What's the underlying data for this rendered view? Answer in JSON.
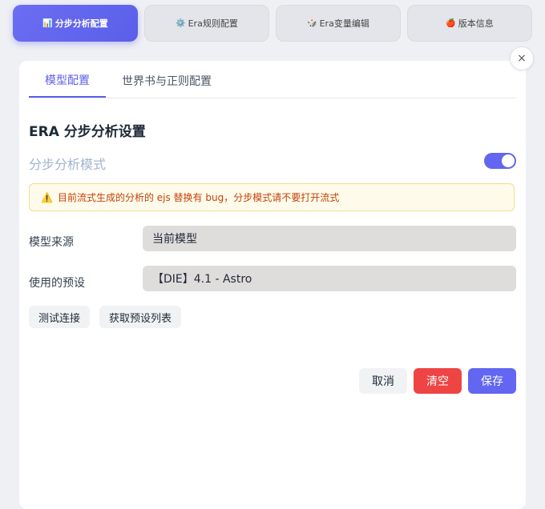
{
  "top_tabs": [
    {
      "icon": "📊",
      "label": "分步分析配置"
    },
    {
      "icon": "⚙️",
      "label": "Era规则配置"
    },
    {
      "icon": "🎲",
      "label": "Era变量编辑"
    },
    {
      "icon": "🍎",
      "label": "版本信息"
    }
  ],
  "close_label": "×",
  "sub_tabs": [
    "模型配置",
    "世界书与正则配置"
  ],
  "section_title": "ERA 分步分析设置",
  "mode_label": "分步分析模式",
  "mode_enabled": true,
  "warning": {
    "icon": "⚠️",
    "text": "目前流式生成的分析的 ejs 替换有 bug，分步模式请不要打开流式"
  },
  "fields": {
    "model_source": {
      "label": "模型来源",
      "value": "当前模型"
    },
    "preset": {
      "label": "使用的预设",
      "value": "【DIE】4.1 - Astro"
    }
  },
  "buttons": {
    "test_connection": "测试连接",
    "fetch_presets": "获取预设列表",
    "cancel": "取消",
    "clear": "清空",
    "save": "保存"
  },
  "colors": {
    "accent": "#6366f1",
    "danger": "#ef4444",
    "warning_bg": "#fffbea"
  }
}
